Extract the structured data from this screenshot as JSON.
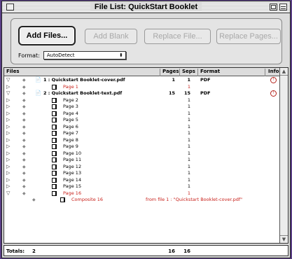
{
  "window": {
    "title": "File List: QuickStart Booklet"
  },
  "toolbar": {
    "add_files": "Add Files...",
    "add_blank": "Add Blank",
    "replace_file": "Replace File...",
    "replace_pages": "Replace Pages...",
    "format_label": "Format:",
    "format_value": "AutoDetect"
  },
  "columns": {
    "files": "Files",
    "pages": "Pages",
    "seps": "Seps",
    "format": "Format",
    "info": "Info"
  },
  "rows": [
    {
      "kind": "file",
      "name": "1 : Quickstart Booklet-cover.pdf",
      "pages": "1",
      "seps": "1",
      "format": "PDF",
      "info": "!",
      "expanded": true
    },
    {
      "kind": "page",
      "name": "Page 1",
      "seps": "1",
      "red": true
    },
    {
      "kind": "file",
      "name": "2 : Quickstart Booklet-text.pdf",
      "pages": "15",
      "seps": "15",
      "format": "PDF",
      "info": "!",
      "expanded": true
    },
    {
      "kind": "page",
      "name": "Page 2",
      "seps": "1"
    },
    {
      "kind": "page",
      "name": "Page 3",
      "seps": "1"
    },
    {
      "kind": "page",
      "name": "Page 4",
      "seps": "1"
    },
    {
      "kind": "page",
      "name": "Page 5",
      "seps": "1"
    },
    {
      "kind": "page",
      "name": "Page 6",
      "seps": "1"
    },
    {
      "kind": "page",
      "name": "Page 7",
      "seps": "1"
    },
    {
      "kind": "page",
      "name": "Page 8",
      "seps": "1"
    },
    {
      "kind": "page",
      "name": "Page 9",
      "seps": "1"
    },
    {
      "kind": "page",
      "name": "Page 10",
      "seps": "1"
    },
    {
      "kind": "page",
      "name": "Page 11",
      "seps": "1"
    },
    {
      "kind": "page",
      "name": "Page 12",
      "seps": "1"
    },
    {
      "kind": "page",
      "name": "Page 13",
      "seps": "1"
    },
    {
      "kind": "page",
      "name": "Page 14",
      "seps": "1"
    },
    {
      "kind": "page",
      "name": "Page 15",
      "seps": "1"
    },
    {
      "kind": "page",
      "name": "Page 16",
      "seps": "1",
      "red": true,
      "expanded": true
    },
    {
      "kind": "composite",
      "name": "Composite 16",
      "note": "from file 1 : \"Quickstart Booklet-cover.pdf\""
    }
  ],
  "totals": {
    "label": "Totals:",
    "files": "2",
    "pages": "16",
    "seps": "16"
  }
}
